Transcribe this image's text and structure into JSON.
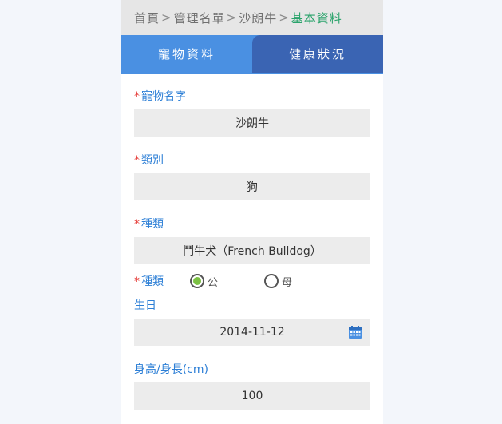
{
  "breadcrumb": {
    "home": "首頁",
    "manage": "管理名單",
    "pet": "沙朗牛",
    "current": "基本資料",
    "separator": ">"
  },
  "tabs": [
    {
      "label": "寵物資料",
      "active": true
    },
    {
      "label": "健康狀況",
      "active": false
    }
  ],
  "colors": {
    "accent": "#4a90e2",
    "required_star": "#e53935",
    "label": "#2d7fd6",
    "breadcrumb_current": "#2aa36b",
    "radio_selected": "#7bc043"
  },
  "form": {
    "required_mark": "*",
    "pet_name": {
      "label": "寵物名字",
      "value": "沙朗牛"
    },
    "category": {
      "label": "類別",
      "value": "狗"
    },
    "breed": {
      "label": "種類",
      "value": "鬥牛犬（French Bulldog）"
    },
    "sex": {
      "label": "種類",
      "options": [
        {
          "label": "公",
          "selected": true
        },
        {
          "label": "母",
          "selected": false
        }
      ]
    },
    "birthday": {
      "label": "生日",
      "value": "2014-11-12",
      "icon": "calendar-icon"
    },
    "height": {
      "label": "身高/身長(cm)",
      "value": "100"
    }
  }
}
